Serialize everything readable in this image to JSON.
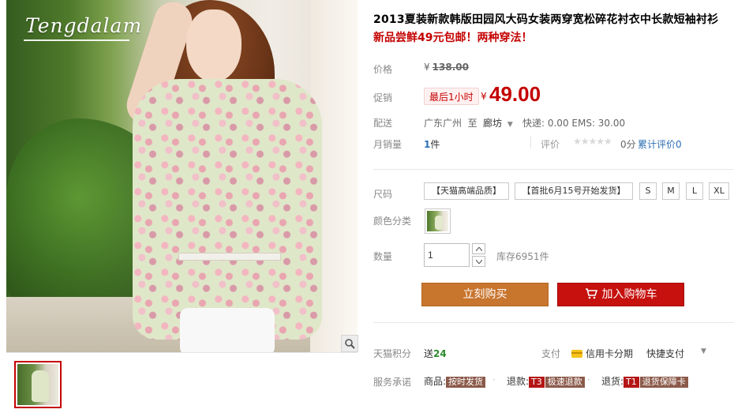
{
  "gallery": {
    "brand_logo": "Tengdalam",
    "zoom_icon": "magnifier-icon"
  },
  "product": {
    "title": "2013夏装新款韩版田园风大码女装两穿宽松碎花衬衣中长款短袖衬衫",
    "subtitle": "新品尝鲜49元包邮！两种穿法！"
  },
  "price": {
    "label": "价格",
    "currency": "¥",
    "original": "138.00"
  },
  "promo": {
    "label": "促销",
    "tag": "最后1小时",
    "currency": "¥",
    "price": "49.00"
  },
  "shipping": {
    "label": "配送",
    "from": "广东广州",
    "to_word": "至",
    "destination": "廊坊",
    "fees": "快递: 0.00 EMS: 30.00"
  },
  "sales": {
    "label": "月销量",
    "count": "1",
    "unit": "件",
    "rating_label": "评价",
    "stars": "★★★★★",
    "score": "0分",
    "reviews": "累计评价0"
  },
  "size": {
    "label": "尺码",
    "options": [
      "【天猫高端品质】",
      "【首批6月15号开始发货】",
      "S",
      "M",
      "L",
      "XL"
    ]
  },
  "color": {
    "label": "颜色分类"
  },
  "quantity": {
    "label": "数量",
    "value": "1",
    "stock": "库存6951件"
  },
  "actions": {
    "buy_now": "立刻购买",
    "add_to_cart": "加入购物车"
  },
  "points": {
    "label": "天猫积分",
    "prefix": "送",
    "value": "24",
    "pay_label": "支付",
    "credit_card": "信用卡分期",
    "quick_pay": "快捷支付"
  },
  "service": {
    "label": "服务承诺",
    "items": [
      {
        "prefix": "商品:",
        "tag": "",
        "badge": "按时发货"
      },
      {
        "prefix": "退款:",
        "tag": "T3",
        "badge": "极速退款"
      },
      {
        "prefix": "退货:",
        "tag": "T1",
        "badge": "退货保障卡"
      }
    ]
  },
  "colors": {
    "accent_red": "#c40000",
    "buy_now_bg": "#c8752e",
    "add_cart_bg": "#c6110e",
    "link_blue": "#2c6fb3"
  }
}
